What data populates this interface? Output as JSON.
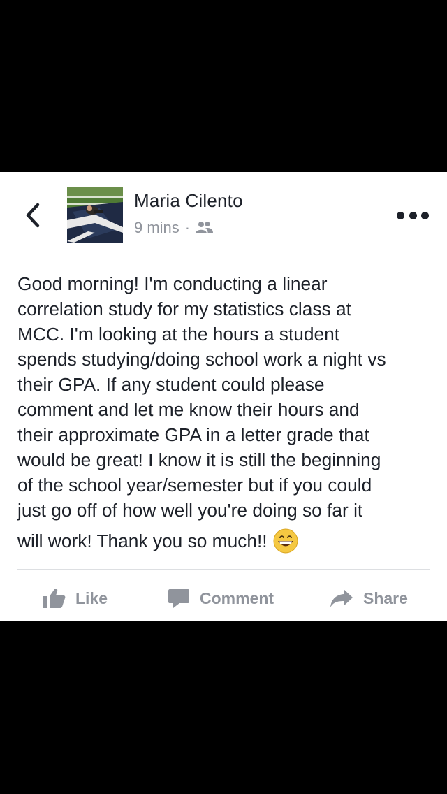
{
  "post": {
    "author": "Maria Cilento",
    "time": "9 mins",
    "separator": "·",
    "audience_icon": "friends-icon",
    "lines": [
      "Good morning! I'm conducting a linear",
      "correlation study for my statistics class at",
      "MCC. I'm looking at the hours a student",
      "spends studying/doing school work a night vs",
      "their GPA. If any student could please",
      "comment and let me know their hours and",
      "their approximate GPA in a letter grade that",
      "would be great! I know it is still the beginning",
      "of the school year/semester but if you could",
      "just go off of how well you're doing so far it"
    ],
    "last_line": "will work! Thank you so much!!",
    "emoji_icon": "grinning-face-icon"
  },
  "actions": {
    "like": "Like",
    "comment": "Comment",
    "share": "Share"
  },
  "colors": {
    "text": "#1d2129",
    "secondary": "#90949c",
    "background": "#000000",
    "card": "#ffffff"
  }
}
